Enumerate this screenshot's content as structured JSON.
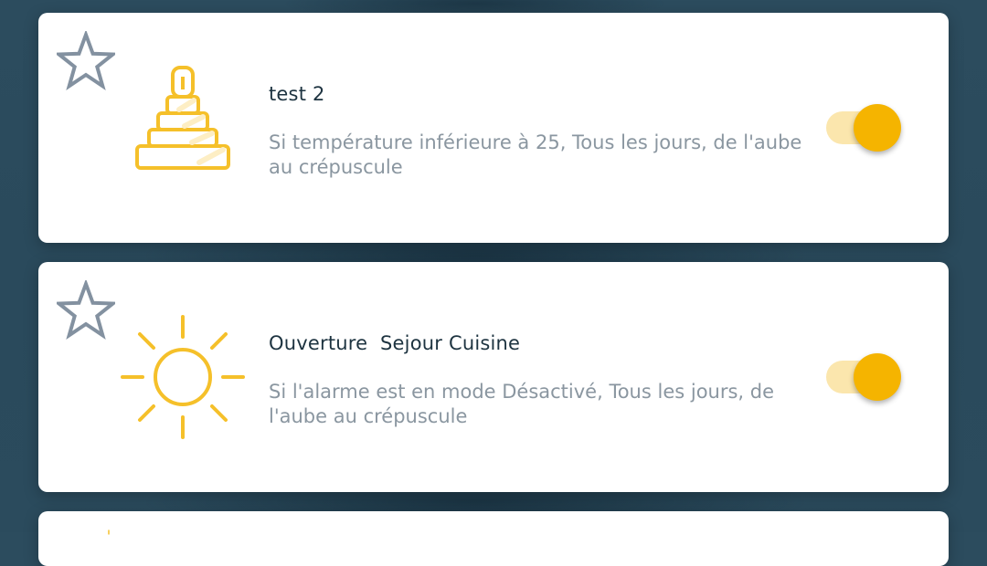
{
  "scenarios": [
    {
      "title": "test 2",
      "description": "Si température inférieure à 25, Tous les jours, de l'aube au crépuscule",
      "icon": "pyramid-toy-icon",
      "favorite": false,
      "enabled": true
    },
    {
      "title": "Ouverture  Sejour Cuisine",
      "description": "Si l'alarme est en mode Désactivé, Tous les jours, de l'aube au crépuscule",
      "icon": "sun-icon",
      "favorite": false,
      "enabled": true
    }
  ],
  "colors": {
    "accent": "#f5b400",
    "accent_light": "#fbe6ad",
    "icon_stroke": "#f5c02a",
    "star_stroke": "#8391a0",
    "title_text": "#1d3340",
    "description_text": "#8a96a0",
    "background": "#2b4b5d"
  }
}
